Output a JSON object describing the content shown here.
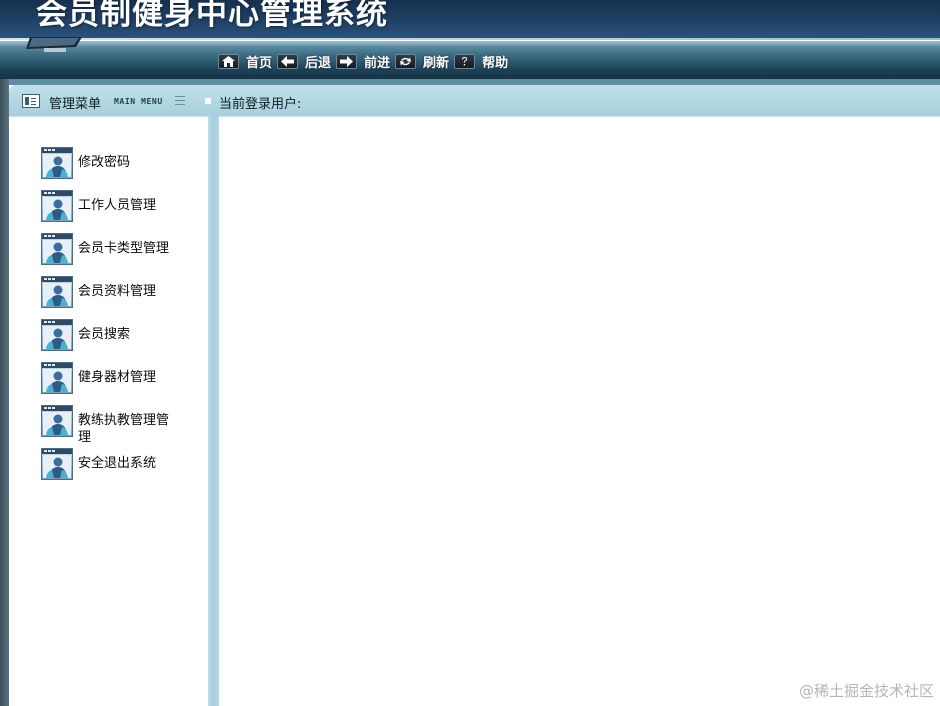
{
  "header": {
    "title": "会员制健身中心管理系统"
  },
  "nav": {
    "items": [
      {
        "label": "首页",
        "icon": "home-icon"
      },
      {
        "label": "后退",
        "icon": "arrow-left-icon"
      },
      {
        "label": "前进",
        "icon": "arrow-right-icon"
      },
      {
        "label": "刷新",
        "icon": "refresh-icon"
      },
      {
        "label": "帮助",
        "icon": "help-icon"
      }
    ]
  },
  "toolbar": {
    "menu_title": "管理菜单",
    "menu_subtitle": "MAIN MENU",
    "current_user_label": "当前登录用户:"
  },
  "sidebar": {
    "items": [
      {
        "label": "修改密码",
        "icon": "user-window-icon"
      },
      {
        "label": "工作人员管理",
        "icon": "user-window-icon"
      },
      {
        "label": "会员卡类型管理",
        "icon": "user-window-icon"
      },
      {
        "label": "会员资料管理",
        "icon": "user-window-icon"
      },
      {
        "label": "会员搜索",
        "icon": "user-window-icon"
      },
      {
        "label": "健身器材管理",
        "icon": "user-window-icon"
      },
      {
        "label": "教练执教管理管理",
        "icon": "user-window-icon"
      },
      {
        "label": "安全退出系统",
        "icon": "user-window-icon"
      }
    ]
  },
  "watermark": {
    "text": "@稀土掘金技术社区"
  },
  "colors": {
    "header_dark": "#1f4268",
    "nav_dark": "#1d4257",
    "toolbar_light": "#a6d0dc",
    "splitter": "#a4cedb"
  }
}
